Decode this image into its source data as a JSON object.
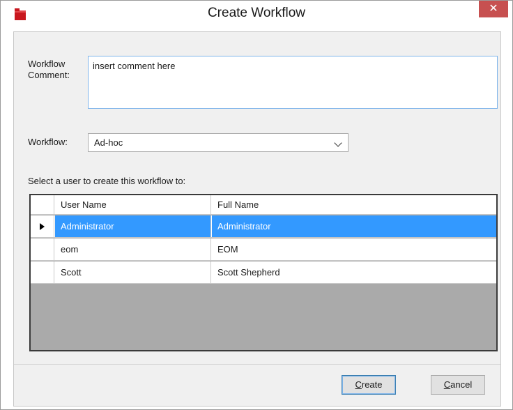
{
  "window": {
    "title": "Create Workflow",
    "close_glyph": "✕",
    "app_icon": "red-document-app-icon"
  },
  "comment": {
    "label_line1": "Workflow",
    "label_line2": "Comment:",
    "value": "insert comment here"
  },
  "workflow": {
    "label": "Workflow:",
    "selected": "Ad-hoc"
  },
  "users": {
    "prompt": "Select a user to create this workflow to:",
    "columns": [
      "User Name",
      "Full Name"
    ],
    "rows": [
      {
        "user_name": "Administrator",
        "full_name": "Administrator",
        "selected": true
      },
      {
        "user_name": "eom",
        "full_name": "EOM",
        "selected": false
      },
      {
        "user_name": "Scott",
        "full_name": "Scott Shepherd",
        "selected": false
      }
    ]
  },
  "buttons": {
    "create_mnemonic": "C",
    "create_rest": "reate",
    "cancel_mnemonic": "C",
    "cancel_rest": "ancel"
  },
  "colors": {
    "selection": "#3399ff",
    "close_button": "#c75050",
    "grid_background": "#aaaaaa"
  }
}
